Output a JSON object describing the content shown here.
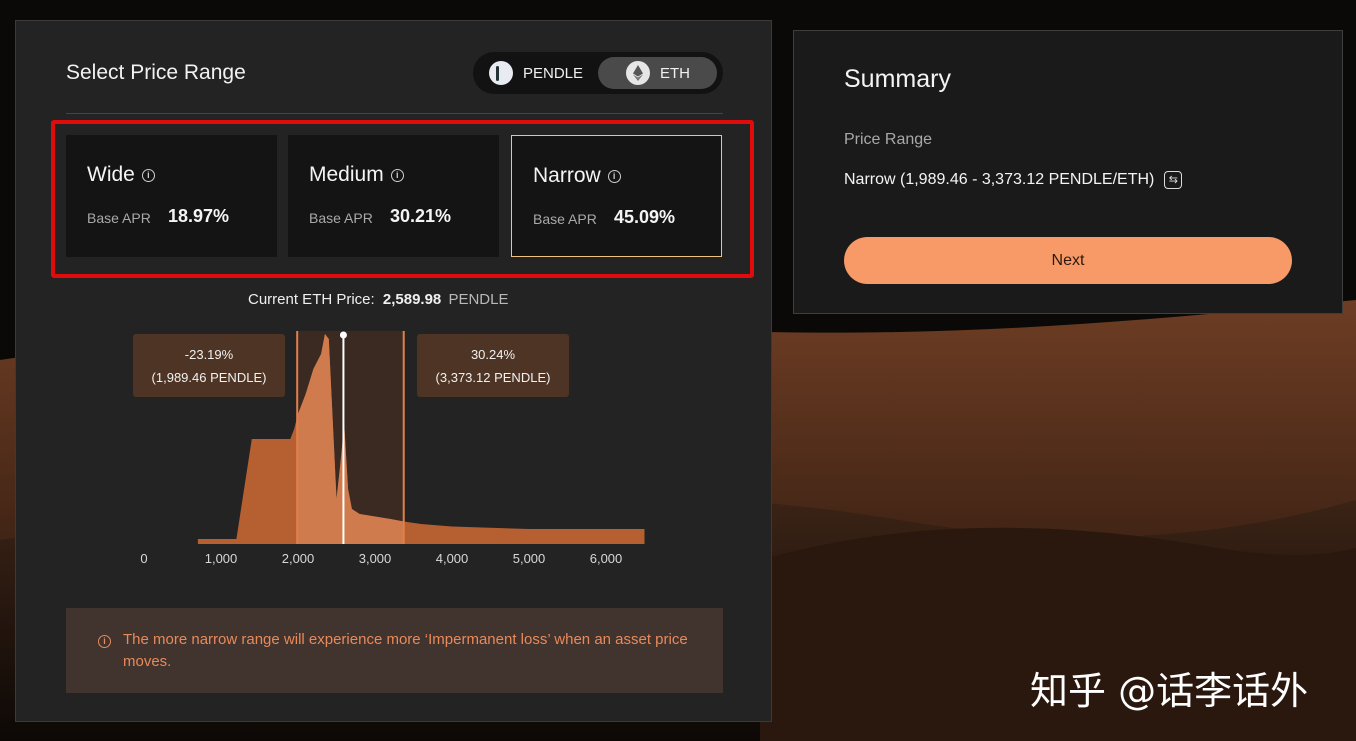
{
  "left_panel": {
    "title": "Select Price Range",
    "token_toggle": {
      "options": [
        {
          "label": "PENDLE",
          "icon": "pendle-icon",
          "selected": false
        },
        {
          "label": "ETH",
          "icon": "eth-icon",
          "selected": true
        }
      ]
    },
    "range_cards": [
      {
        "name": "Wide",
        "apr_label": "Base APR",
        "apr": "18.97%",
        "selected": false
      },
      {
        "name": "Medium",
        "apr_label": "Base APR",
        "apr": "30.21%",
        "selected": false
      },
      {
        "name": "Narrow",
        "apr_label": "Base APR",
        "apr": "45.09%",
        "selected": true
      }
    ],
    "current_price": {
      "label": "Current ETH Price:",
      "value": "2,589.98",
      "unit": "PENDLE"
    },
    "range_low": {
      "pct": "-23.19%",
      "price": "(1,989.46 PENDLE)"
    },
    "range_high": {
      "pct": "30.24%",
      "price": "(3,373.12 PENDLE)"
    },
    "warning": "The more narrow range will experience more ‘Impermanent loss’ when an asset price moves."
  },
  "chart_data": {
    "type": "area",
    "x_ticks": [
      "0",
      "1,000",
      "2,000",
      "3,000",
      "4,000",
      "5,000",
      "6,000"
    ],
    "xlim": [
      0,
      6500
    ],
    "current_price": 2589.98,
    "range": [
      1989.46,
      3373.12
    ],
    "x": [
      700,
      1200,
      1400,
      1600,
      1800,
      1900,
      1950,
      2000,
      2100,
      2200,
      2300,
      2350,
      2400,
      2500,
      2550,
      2600,
      2650,
      2700,
      2800,
      3000,
      3200,
      3373,
      3600,
      4000,
      5000,
      6000,
      6500
    ],
    "y": [
      1,
      1,
      21,
      21,
      21,
      21,
      23,
      26,
      30,
      35,
      38,
      42,
      41,
      9,
      16,
      24,
      11,
      7,
      6,
      5.5,
      5,
      4.5,
      4,
      3.5,
      3,
      3,
      3
    ],
    "grid": false
  },
  "summary": {
    "title": "Summary",
    "price_range_label": "Price Range",
    "price_range_value": "Narrow (1,989.46 - 3,373.12 PENDLE/ETH)",
    "next_label": "Next"
  },
  "watermark": "知乎 @话李话外",
  "colors": {
    "accent": "#f79a67",
    "selected_border": "#f0c27a",
    "highlight": "#e00b0b",
    "chart_fill": "#b65f31",
    "chart_range_fill": "#d07b4d"
  }
}
